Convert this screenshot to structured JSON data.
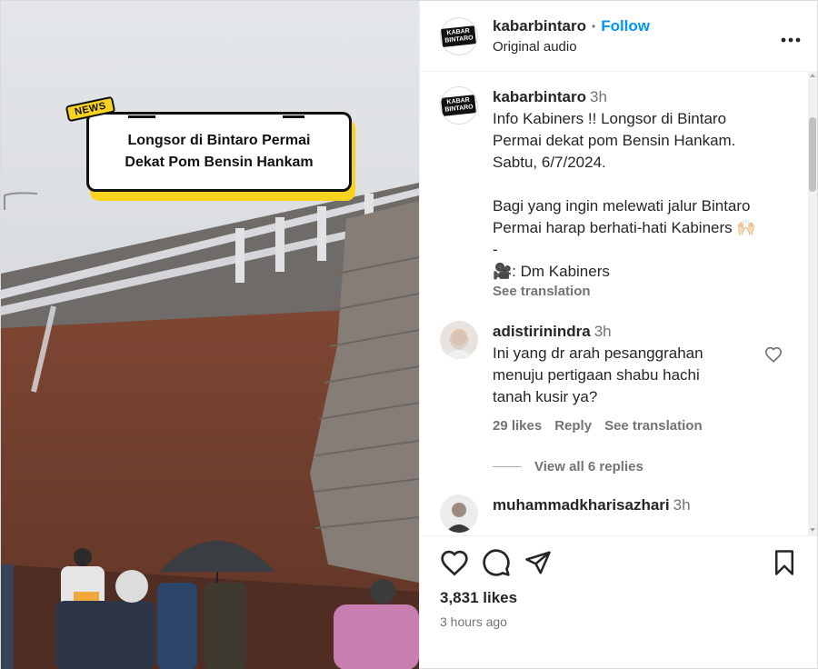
{
  "media": {
    "news_tag": "NEWS",
    "headline_line1": "Longsor di Bintaro Permai",
    "headline_line2": "Dekat Pom Bensin Hankam"
  },
  "header": {
    "logo_text_1": "KABAR",
    "logo_text_2": "BINTARO",
    "username": "kabarbintaro",
    "separator": "•",
    "follow_label": "Follow",
    "audio_label": "Original audio",
    "more_icon": "more-horizontal-icon"
  },
  "caption": {
    "username": "kabarbintaro",
    "time": "3h",
    "lines": [
      "Info Kabiners !! Longsor di Bintaro",
      "Permai dekat pom Bensin Hankam.",
      "Sabtu, 6/7/2024.",
      "",
      "Bagi yang ingin melewati jalur Bintaro",
      "Permai harap berhati-hati Kabiners 🙌🏻",
      "-",
      "🎥: Dm Kabiners"
    ],
    "see_translation": "See translation"
  },
  "comments": [
    {
      "username": "adistirinindra",
      "time": "3h",
      "lines": [
        "Ini yang dr arah pesanggrahan",
        "menuju pertigaan shabu hachi",
        "tanah kusir ya?"
      ],
      "likes": "29 likes",
      "reply": "Reply",
      "see_translation": "See translation",
      "view_replies": "View all 6 replies"
    },
    {
      "username": "muhammadkharisazhari",
      "time": "3h"
    }
  ],
  "footer": {
    "likes": "3,831 likes",
    "ago": "3 hours ago",
    "icons": [
      "heart-icon",
      "comment-icon",
      "share-icon",
      "bookmark-icon"
    ]
  },
  "colors": {
    "accent": "#0095f6",
    "muted": "#737373",
    "news_yellow": "#f7d21f"
  }
}
